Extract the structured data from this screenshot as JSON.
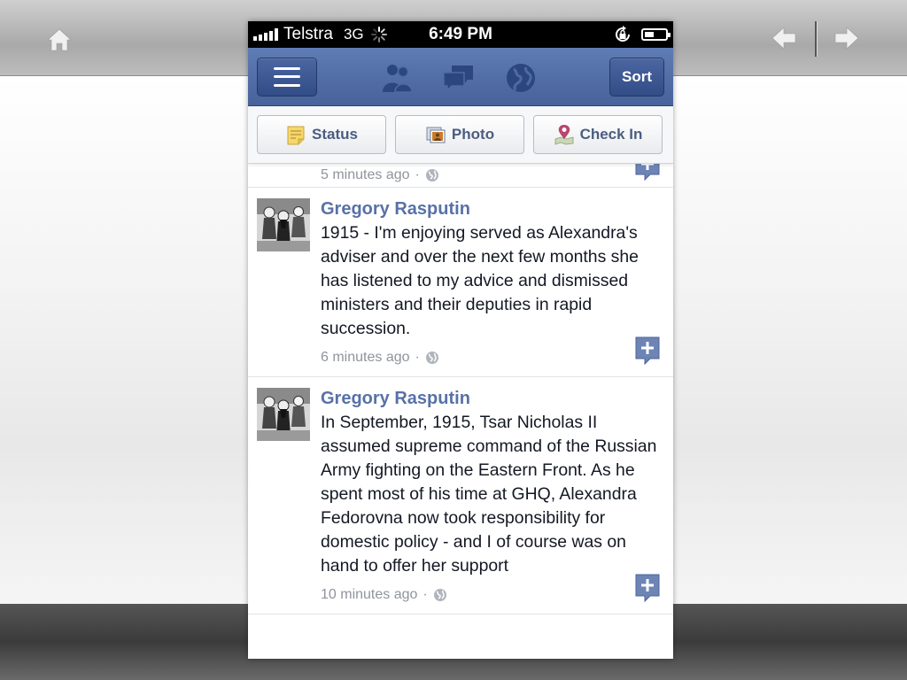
{
  "status_bar": {
    "carrier": "Telstra",
    "network": "3G",
    "time": "6:49 PM"
  },
  "header": {
    "sort_label": "Sort",
    "icons": [
      "friend-requests-icon",
      "messages-icon",
      "notifications-globe-icon"
    ]
  },
  "publisher": {
    "status_label": "Status",
    "photo_label": "Photo",
    "checkin_label": "Check In"
  },
  "partial_story": {
    "timestamp": "5 minutes ago",
    "separator": "·"
  },
  "stories": [
    {
      "author": "Gregory Rasputin",
      "message": "1915 - I'm enjoying served as Alexandra's adviser and over the next few months she has listened to my advice and dismissed ministers and their deputies in rapid succession.",
      "timestamp": "6 minutes ago",
      "separator": "·"
    },
    {
      "author": "Gregory Rasputin",
      "message": "In September, 1915, Tsar Nicholas II assumed supreme command of the Russian Army fighting on the Eastern Front. As he spent most of his time at GHQ, Alexandra Fedorovna now took responsibility for domestic policy - and I of course was on hand to offer her support",
      "timestamp": "10 minutes ago",
      "separator": "·"
    }
  ],
  "colors": {
    "facebook_blue": "#3b5998",
    "header_bar": "#4f6aa3",
    "meta_gray": "#90949c"
  }
}
